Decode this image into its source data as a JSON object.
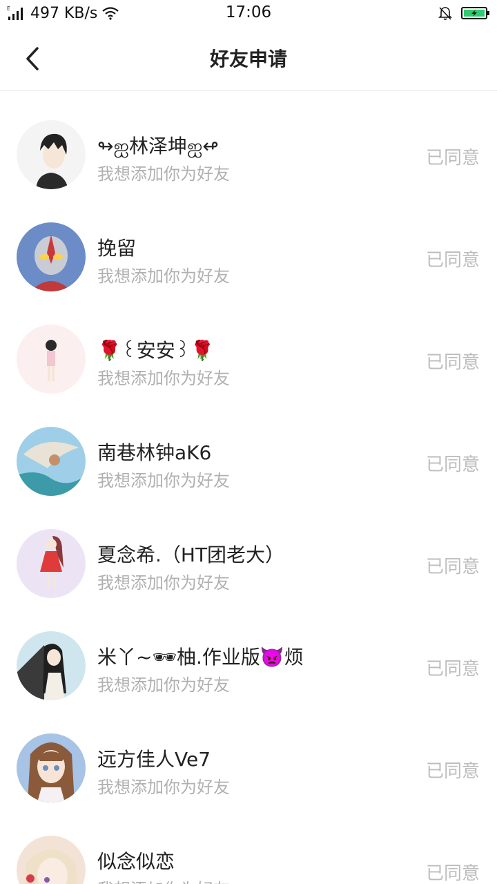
{
  "status_bar": {
    "network": "497 KB/s",
    "time": "17:06"
  },
  "header": {
    "title": "好友申请"
  },
  "requests": [
    {
      "name": "↬ஐ林泽坤ஐ↫",
      "message": "我想添加你为好友",
      "status": "已同意",
      "avatar_color": "#f4f4f4"
    },
    {
      "name": "挽留",
      "message": "我想添加你为好友",
      "status": "已同意",
      "avatar_color": "#6c8cc8"
    },
    {
      "name": "🌹꒰安安꒱🌹",
      "message": "我想添加你为好友",
      "status": "已同意",
      "avatar_color": "#fbeff0"
    },
    {
      "name": "南巷林钟aK6",
      "message": "我想添加你为好友",
      "status": "已同意",
      "avatar_color": "#9fcfe8"
    },
    {
      "name": "夏念希.（HT团老大）",
      "message": "我想添加你为好友",
      "status": "已同意",
      "avatar_color": "#ece4f5"
    },
    {
      "name": "米丫~🕶柚.作业版👿烦",
      "message": "我想添加你为好友",
      "status": "已同意",
      "avatar_color": "#cfe6ee"
    },
    {
      "name": "远方佳人Ve7",
      "message": "我想添加你为好友",
      "status": "已同意",
      "avatar_color": "#a7c3e6"
    },
    {
      "name": "似念似恋",
      "message": "我想添加你为好友",
      "status": "已同意",
      "avatar_color": "#f3e3d6"
    }
  ]
}
